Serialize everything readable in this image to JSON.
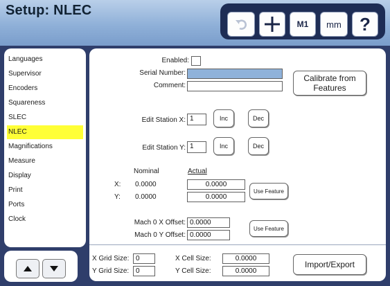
{
  "header": {
    "title": "Setup: NLEC",
    "toolbar": {
      "undo_icon": "undo-arrow-icon",
      "crosshair_icon": "crosshair-plus-icon",
      "m1_label": "M1",
      "mm_label": "mm",
      "help_label": "?"
    }
  },
  "sidebar": {
    "items": [
      {
        "label": "Languages"
      },
      {
        "label": "Supervisor"
      },
      {
        "label": "Encoders"
      },
      {
        "label": "Squareness"
      },
      {
        "label": "SLEC"
      },
      {
        "label": "NLEC"
      },
      {
        "label": "Magnifications"
      },
      {
        "label": "Measure"
      },
      {
        "label": "Display"
      },
      {
        "label": "Print"
      },
      {
        "label": "Ports"
      },
      {
        "label": "Clock"
      }
    ],
    "selected": "NLEC",
    "selected_color": "#ffff36",
    "up_icon": "triangle-up-icon",
    "down_icon": "triangle-down-icon"
  },
  "form": {
    "enabled_label": "Enabled:",
    "enabled_checked": false,
    "serial_label": "Serial Number:",
    "serial_value": "",
    "comment_label": "Comment:",
    "comment_value": "",
    "calibrate_button": "Calibrate from Features",
    "station_x_label": "Edit Station X:",
    "station_x_value": "1",
    "station_y_label": "Edit Station Y:",
    "station_y_value": "1",
    "inc_label": "Inc",
    "dec_label": "Dec",
    "nominal_header": "Nominal",
    "actual_header": "Actual",
    "x_label": "X:",
    "y_label": "Y:",
    "x_nominal": "0.0000",
    "y_nominal": "0.0000",
    "x_actual": "0.0000",
    "y_actual": "0.0000",
    "use_feature_label": "Use Feature",
    "mach_x_label": "Mach 0 X Offset:",
    "mach_x_value": "0.0000",
    "mach_y_label": "Mach 0 Y Offset:",
    "mach_y_value": "0.0000",
    "x_grid_label": "X Grid Size:",
    "x_grid_value": "0",
    "y_grid_label": "Y Grid Size:",
    "y_grid_value": "0",
    "x_cell_label": "X Cell Size:",
    "x_cell_value": "0.0000",
    "y_cell_label": "Y Cell Size:",
    "y_cell_value": "0.0000",
    "import_export_button": "Import/Export",
    "serial_field_color": "#8fb2da"
  }
}
